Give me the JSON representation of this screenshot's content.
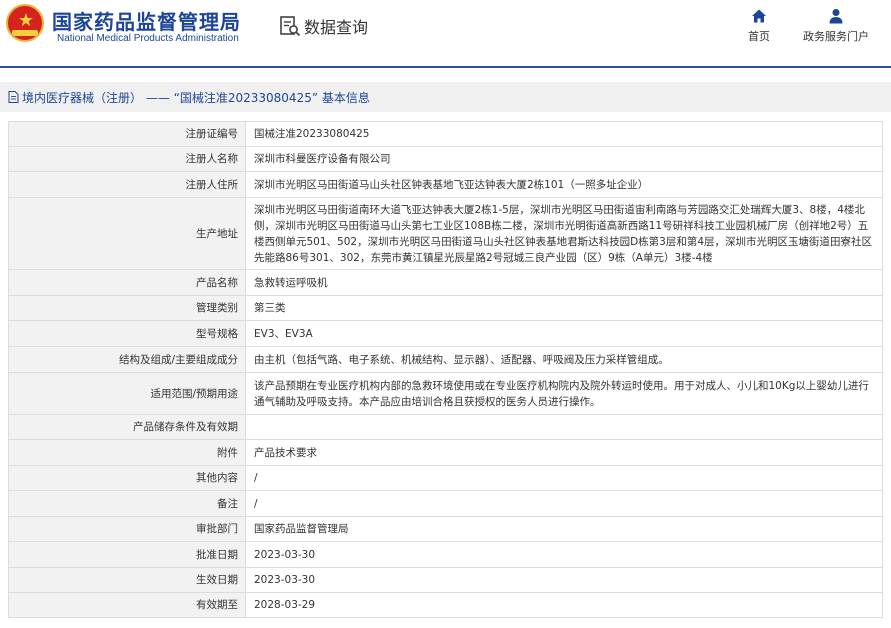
{
  "header": {
    "title_cn": "国家药品监督管理局",
    "title_en": "National Medical Products Administration",
    "search_label": "数据查询",
    "nav": {
      "home": "首页",
      "service": "政务服务门户"
    }
  },
  "breadcrumb": {
    "text": "境内医疗器械（注册） —— “国械注准20233080425” 基本信息"
  },
  "colors": {
    "brand_blue": "#1d4597",
    "emblem_red": "#d5231d",
    "emblem_gold": "#f6cf3d",
    "label_bg": "#f2f2f2",
    "crumb_bg": "#f0f0f0"
  },
  "icons": {
    "logo": "national-emblem",
    "search": "document-search-icon",
    "home": "home-icon",
    "service": "user-icon",
    "crumb": "document-icon"
  },
  "records": [
    {
      "label": "注册证编号",
      "value": "国械注准20233080425"
    },
    {
      "label": "注册人名称",
      "value": "深圳市科曼医疗设备有限公司"
    },
    {
      "label": "注册人住所",
      "value": "深圳市光明区马田街道马山头社区钟表基地飞亚达钟表大厦2栋101（一照多址企业）"
    },
    {
      "label": "生产地址",
      "value": "深圳市光明区马田街道南环大道飞亚达钟表大厦2栋1-5层，深圳市光明区马田街道宙利南路与芳园路交汇处瑞辉大厦3、8楼，4楼北侧，深圳市光明区马田街道马山头第七工业区108B栋二楼，深圳市光明街道高新西路11号研祥科技工业园机械厂房（创祥地2号）五楼西侧单元501、502，深圳市光明区马田街道马山头社区钟表基地君斯达科技园D栋第3层和第4层，深圳市光明区玉塘街道田寮社区先能路86号301、302，东莞市黄江镇星光辰星路2号冠城三良产业园（区）9栋（A单元）3楼-4楼"
    },
    {
      "label": "产品名称",
      "value": "急救转运呼吸机"
    },
    {
      "label": "管理类别",
      "value": "第三类"
    },
    {
      "label": "型号规格",
      "value": "EV3、EV3A"
    },
    {
      "label": "结构及组成/主要组成成分",
      "value": "由主机（包括气路、电子系统、机械结构、显示器）、适配器、呼吸阀及压力采样管组成。"
    },
    {
      "label": "适用范围/预期用途",
      "value": "该产品预期在专业医疗机构内部的急救环境使用或在专业医疗机构院内及院外转运时使用。用于对成人、小儿和10Kg以上婴幼儿进行通气辅助及呼吸支持。本产品应由培训合格且获授权的医务人员进行操作。"
    },
    {
      "label": "产品储存条件及有效期",
      "value": ""
    },
    {
      "label": "附件",
      "value": "产品技术要求"
    },
    {
      "label": "其他内容",
      "value": "/"
    },
    {
      "label": "备注",
      "value": "/"
    },
    {
      "label": "审批部门",
      "value": "国家药品监督管理局"
    },
    {
      "label": "批准日期",
      "value": "2023-03-30"
    },
    {
      "label": "生效日期",
      "value": "2023-03-30"
    },
    {
      "label": "有效期至",
      "value": "2028-03-29"
    }
  ]
}
